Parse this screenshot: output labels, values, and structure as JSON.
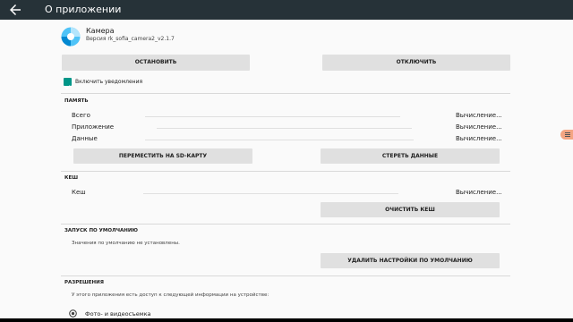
{
  "header": {
    "title": "О приложении"
  },
  "app": {
    "name": "Камера",
    "version": "Версия rk_sofia_camera2_v2.1.7"
  },
  "buttons": {
    "stop": "ОСТАНОВИТЬ",
    "disable": "ОТКЛЮЧИТЬ",
    "move_sd": "ПЕРЕМЕСТИТЬ НА SD-КАРТУ",
    "clear_data": "СТЕРЕТЬ ДАННЫЕ",
    "clear_cache": "ОЧИСТИТЬ КЕШ",
    "clear_defaults": "УДАЛИТЬ НАСТРОЙКИ ПО УМОЛЧАНИЮ"
  },
  "notifications": {
    "label": "Включить уведомления",
    "checked": true
  },
  "memory": {
    "title": "ПАМЯТЬ",
    "rows": [
      {
        "label": "Всего",
        "value": "Вычисление..."
      },
      {
        "label": "Приложение",
        "value": "Вычисление..."
      },
      {
        "label": "Данные",
        "value": "Вычисление..."
      }
    ]
  },
  "cache": {
    "title": "КЕШ",
    "label": "Кеш",
    "value": "Вычисление..."
  },
  "defaults": {
    "title": "ЗАПУСК ПО УМОЛЧАНИЮ",
    "note": "Значения по умолчанию не установлены."
  },
  "permissions": {
    "title": "РАЗРЕШЕНИЯ",
    "note": "У этого приложения есть доступ к следующей информации на устройстве:",
    "items": [
      {
        "label": "Фото- и видеосъемка",
        "icon": "camera-icon"
      }
    ]
  },
  "colors": {
    "toolbar": "#263238",
    "accent": "#009688"
  }
}
